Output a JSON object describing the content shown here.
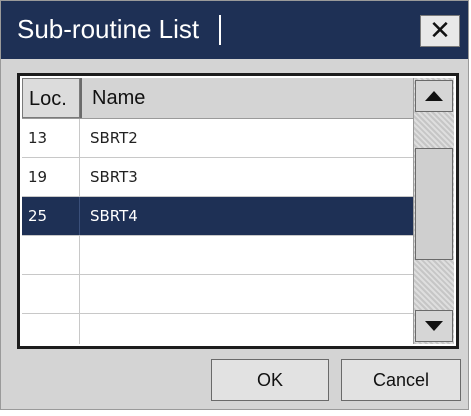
{
  "dialog": {
    "title": "Sub-routine List",
    "close_icon": "close-icon"
  },
  "list": {
    "columns": [
      "Loc.",
      "Name"
    ],
    "rows": [
      {
        "loc": "13",
        "name": "SBRT2",
        "selected": false
      },
      {
        "loc": "19",
        "name": "SBRT3",
        "selected": false
      },
      {
        "loc": "25",
        "name": "SBRT4",
        "selected": true
      },
      {
        "loc": "",
        "name": "",
        "selected": false
      },
      {
        "loc": "",
        "name": "",
        "selected": false
      },
      {
        "loc": "",
        "name": "",
        "selected": false
      }
    ]
  },
  "scrollbar": {
    "up_icon": "arrow-up-icon",
    "down_icon": "arrow-down-icon"
  },
  "buttons": {
    "ok": "OK",
    "cancel": "Cancel"
  },
  "colors": {
    "titlebar": "#1e3055",
    "selection": "#1e3055",
    "dialog_bg": "#d4d4d4"
  }
}
